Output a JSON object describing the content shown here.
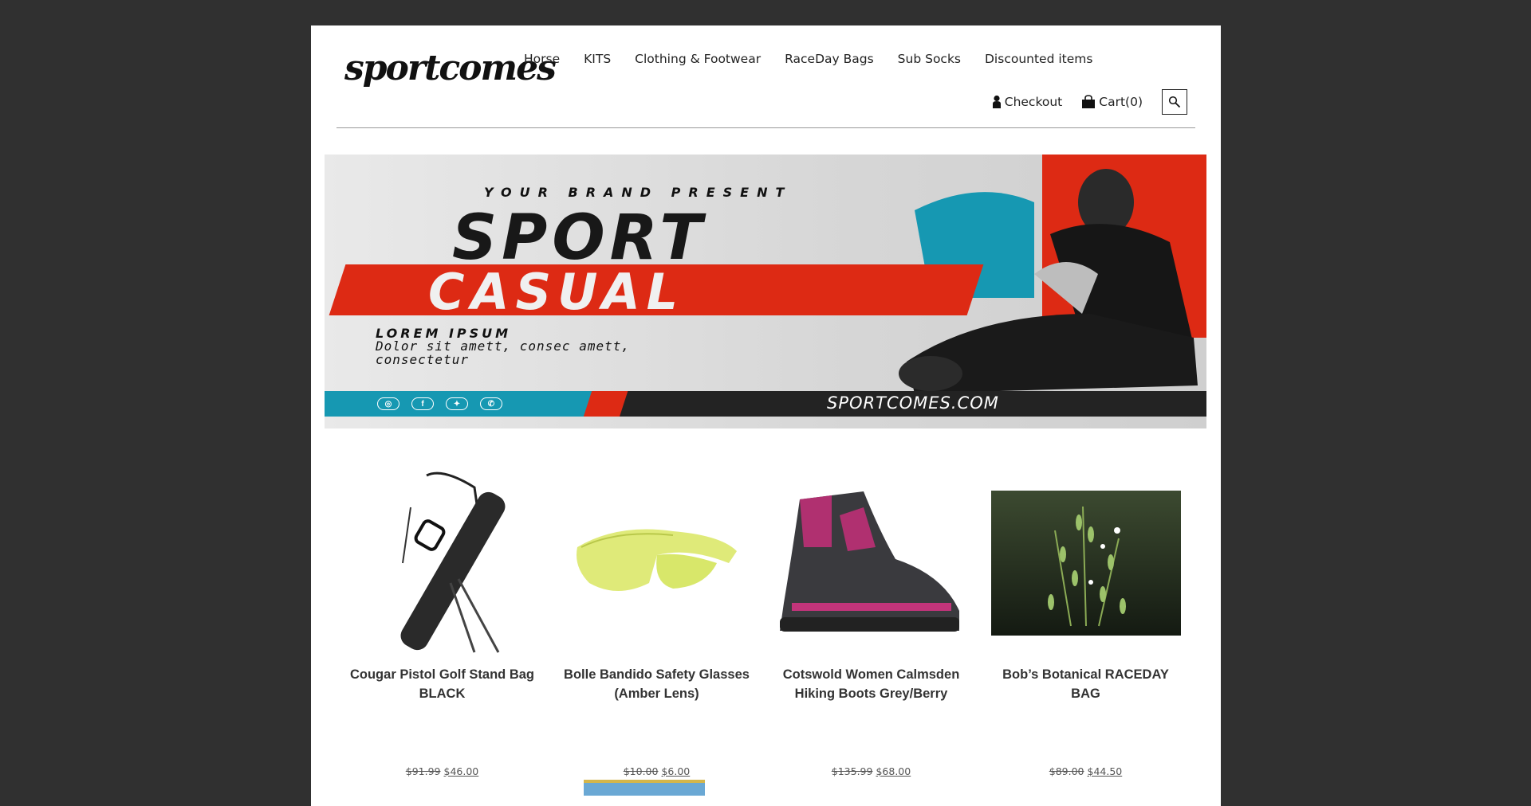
{
  "header": {
    "logo": "sportcomes",
    "nav": [
      "Horse",
      "KITS",
      "Clothing & Footwear",
      "RaceDay Bags",
      "Sub Socks",
      "Discounted items"
    ],
    "checkout": "Checkout",
    "cart": "Cart(0)",
    "icons": {
      "checkout": "user-icon",
      "cart": "shopping-bag-icon",
      "search": "search-icon"
    }
  },
  "banner": {
    "line1": "YOUR BRAND PRESENT",
    "line2": "SPORT",
    "line3": "CASUAL",
    "line4": "LOREM IPSUM",
    "line5": "Dolor sit amett, consec amett, consectetur",
    "url": "SPORTCOMES.COM",
    "socials": [
      "instagram-icon",
      "facebook-icon",
      "twitter-icon",
      "whatsapp-icon"
    ],
    "colors": {
      "red": "#dd2a14",
      "teal": "#1698b2",
      "dark": "#232323"
    }
  },
  "products": [
    {
      "title": "Cougar Pistol Golf Stand Bag BLACK",
      "old_price": "$91.99",
      "new_price": "$46.00",
      "image": "golf-bag-icon"
    },
    {
      "title": "Bolle Bandido Safety Glasses (Amber Lens)",
      "old_price": "$10.00",
      "new_price": "$6.00",
      "image": "safety-glasses-icon"
    },
    {
      "title": "Cotswold Women Calmsden Hiking Boots Grey/Berry",
      "old_price": "$135.99",
      "new_price": "$68.00",
      "image": "hiking-boot-icon"
    },
    {
      "title": "Bob’s Botanical RACEDAY BAG",
      "old_price": "$89.00",
      "new_price": "$44.50",
      "image": "botanical-print-icon"
    }
  ]
}
